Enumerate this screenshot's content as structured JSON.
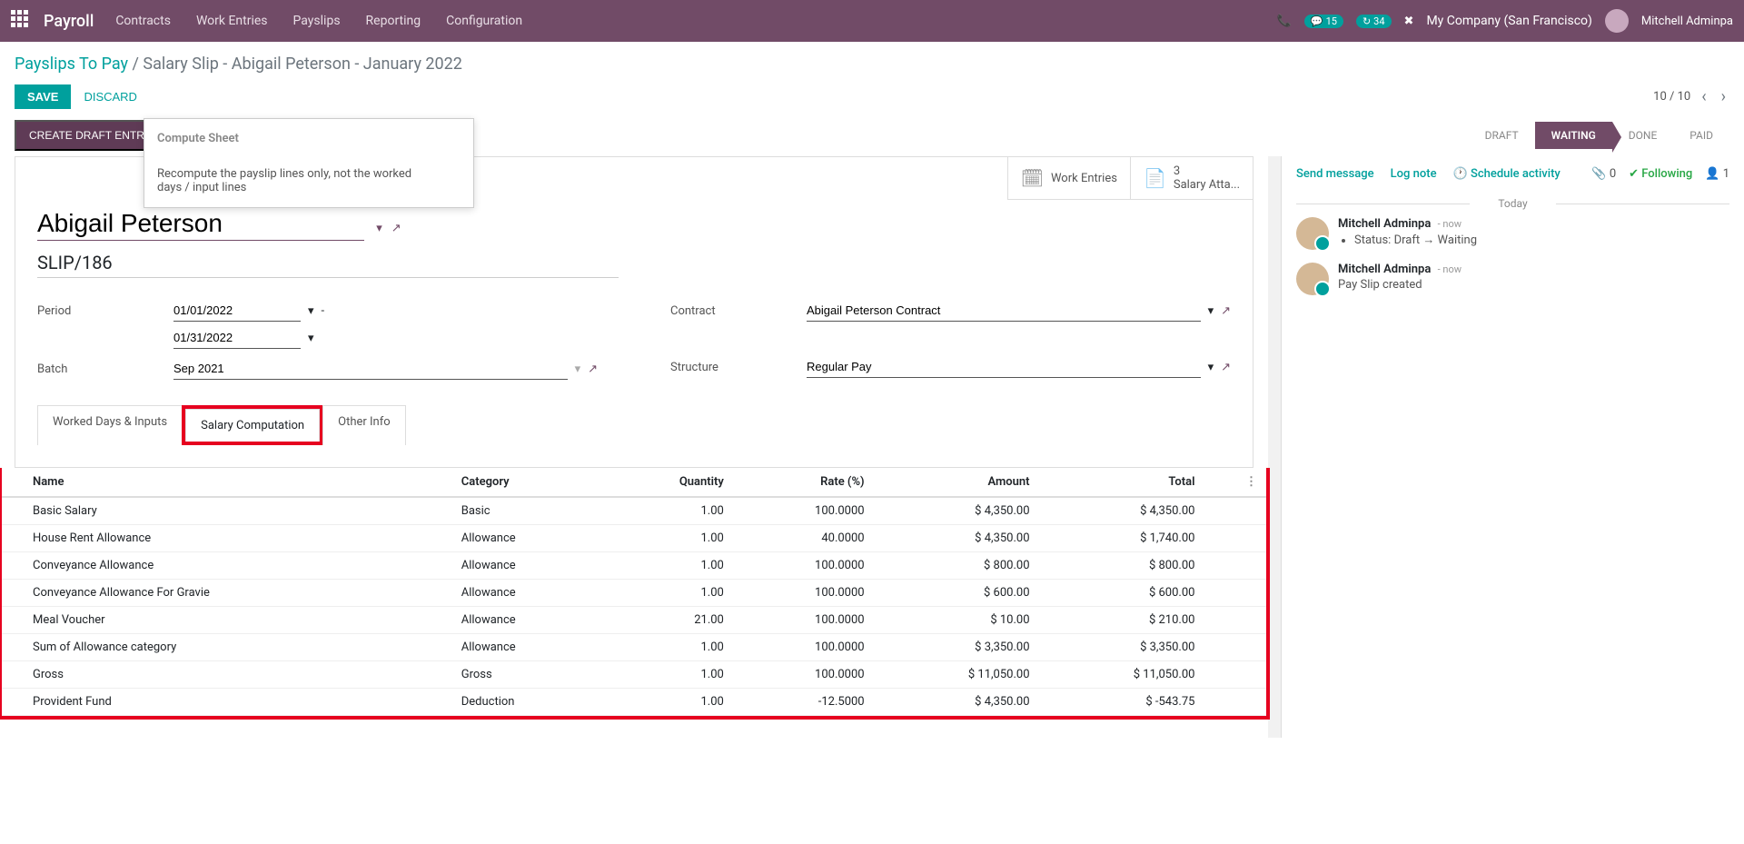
{
  "topbar": {
    "app_name": "Payroll",
    "nav": [
      "Contracts",
      "Work Entries",
      "Payslips",
      "Reporting",
      "Configuration"
    ],
    "msg_count": "15",
    "call_count": "34",
    "company": "My Company (San Francisco)",
    "user": "Mitchell Adminpa"
  },
  "breadcrumb": {
    "root": "Payslips To Pay",
    "current": "Salary Slip - Abigail Peterson - January 2022"
  },
  "actions": {
    "save": "SAVE",
    "discard": "DISCARD",
    "pager": "10 / 10"
  },
  "tooltip": {
    "title": "Compute Sheet",
    "body": "Recompute the payslip lines only, not the worked days / input lines"
  },
  "statusbar": {
    "create_draft": "CREATE DRAFT ENTRY",
    "steps": [
      "DRAFT",
      "WAITING",
      "DONE",
      "PAID"
    ]
  },
  "stat_buttons": {
    "work_entries": "Work Entries",
    "salary_att_count": "3",
    "salary_att": "Salary Atta..."
  },
  "form": {
    "employee": "Abigail Peterson",
    "ref": "SLIP/186",
    "labels": {
      "period": "Period",
      "batch": "Batch",
      "contract": "Contract",
      "structure": "Structure"
    },
    "period_from": "01/01/2022",
    "period_to": "01/31/2022",
    "batch": "Sep 2021",
    "contract": "Abigail Peterson Contract",
    "structure": "Regular Pay"
  },
  "tabs": [
    "Worked Days & Inputs",
    "Salary Computation",
    "Other Info"
  ],
  "table": {
    "headers": [
      "Name",
      "Category",
      "Quantity",
      "Rate (%)",
      "Amount",
      "Total"
    ],
    "rows": [
      {
        "name": "Basic Salary",
        "cat": "Basic",
        "qty": "1.00",
        "rate": "100.0000",
        "amt": "$ 4,350.00",
        "total": "$ 4,350.00"
      },
      {
        "name": "House Rent Allowance",
        "cat": "Allowance",
        "qty": "1.00",
        "rate": "40.0000",
        "amt": "$ 4,350.00",
        "total": "$ 1,740.00"
      },
      {
        "name": "Conveyance Allowance",
        "cat": "Allowance",
        "qty": "1.00",
        "rate": "100.0000",
        "amt": "$ 800.00",
        "total": "$ 800.00"
      },
      {
        "name": "Conveyance Allowance For Gravie",
        "cat": "Allowance",
        "qty": "1.00",
        "rate": "100.0000",
        "amt": "$ 600.00",
        "total": "$ 600.00"
      },
      {
        "name": "Meal Voucher",
        "cat": "Allowance",
        "qty": "21.00",
        "rate": "100.0000",
        "amt": "$ 10.00",
        "total": "$ 210.00"
      },
      {
        "name": "Sum of Allowance category",
        "cat": "Allowance",
        "qty": "1.00",
        "rate": "100.0000",
        "amt": "$ 3,350.00",
        "total": "$ 3,350.00"
      },
      {
        "name": "Gross",
        "cat": "Gross",
        "qty": "1.00",
        "rate": "100.0000",
        "amt": "$ 11,050.00",
        "total": "$ 11,050.00"
      },
      {
        "name": "Provident Fund",
        "cat": "Deduction",
        "qty": "1.00",
        "rate": "-12.5000",
        "amt": "$ 4,350.00",
        "total": "$ -543.75"
      }
    ]
  },
  "chatter": {
    "send": "Send message",
    "log": "Log note",
    "schedule": "Schedule activity",
    "attach": "0",
    "following": "Following",
    "followers": "1",
    "today": "Today",
    "messages": [
      {
        "author": "Mitchell Adminpa",
        "time": "now",
        "status_label": "Status:",
        "status_from": "Draft",
        "status_to": "Waiting"
      },
      {
        "author": "Mitchell Adminpa",
        "time": "now",
        "text": "Pay Slip created"
      }
    ]
  }
}
